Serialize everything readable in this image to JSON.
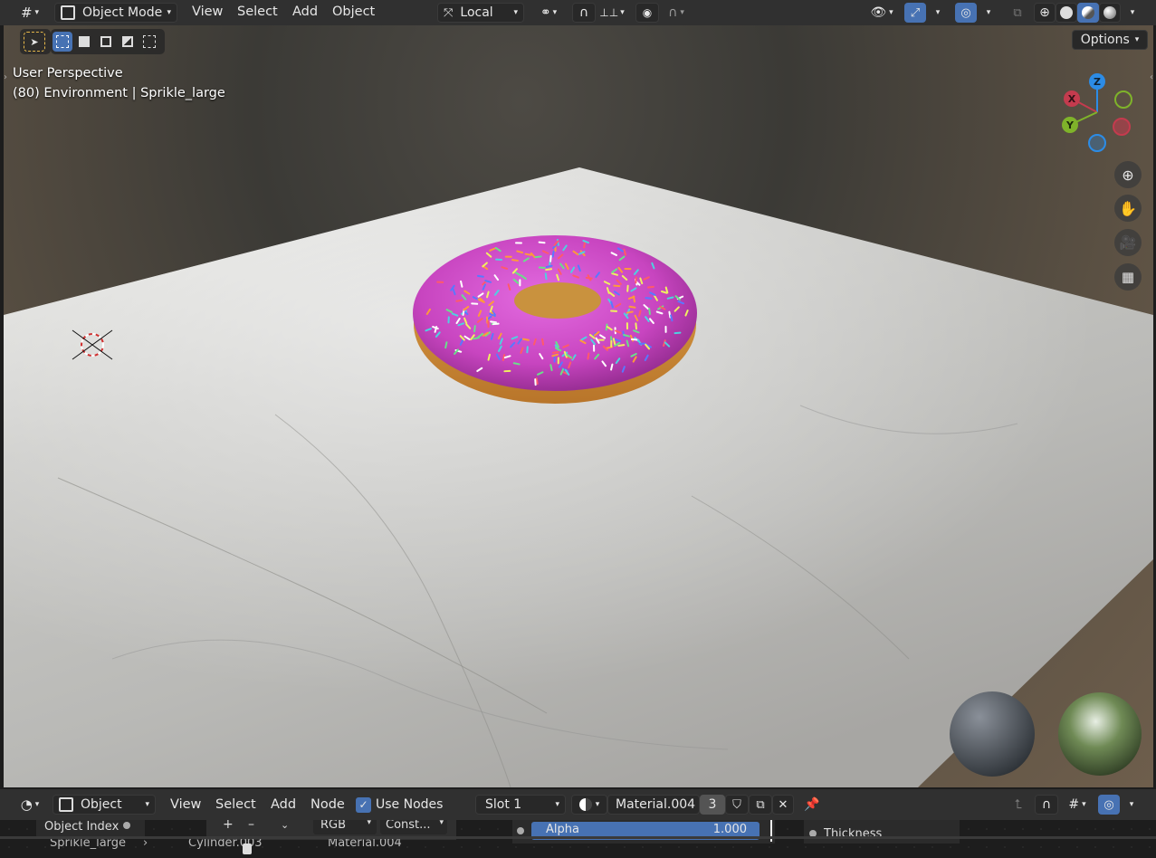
{
  "header": {
    "mode": "Object Mode",
    "menus": [
      "View",
      "Select",
      "Add",
      "Object"
    ],
    "orientation": "Local",
    "options_label": "Options"
  },
  "viewport": {
    "perspective_label": "User Perspective",
    "object_info": "(80) Environment | Sprikle_large"
  },
  "gizmo": {
    "z": "Z",
    "x": "X",
    "y": "Y"
  },
  "node_editor": {
    "header": {
      "object_dropdown": "Object",
      "menus": [
        "View",
        "Select",
        "Add",
        "Node"
      ],
      "use_nodes_label": "Use Nodes",
      "use_nodes_checked": true,
      "slot": "Slot 1",
      "material": "Material.004",
      "users": "3"
    },
    "canvas": {
      "object_index_label": "Object Index",
      "rgb_label": "RGB",
      "const_label": "Const...",
      "alpha_label": "Alpha",
      "alpha_value": "1.000",
      "thickness_label": "Thickness",
      "breadcrumb_1": "Sprikle_large",
      "breadcrumb_2": "Cylinder.003",
      "breadcrumb_3": "Material.004"
    }
  },
  "colors": {
    "accent": "#4772b3",
    "axis_x": "#c43b4e",
    "axis_y": "#7fb32a",
    "axis_z": "#2c8ce6",
    "frosting": "#c845c0",
    "dough": "#c98a35"
  }
}
